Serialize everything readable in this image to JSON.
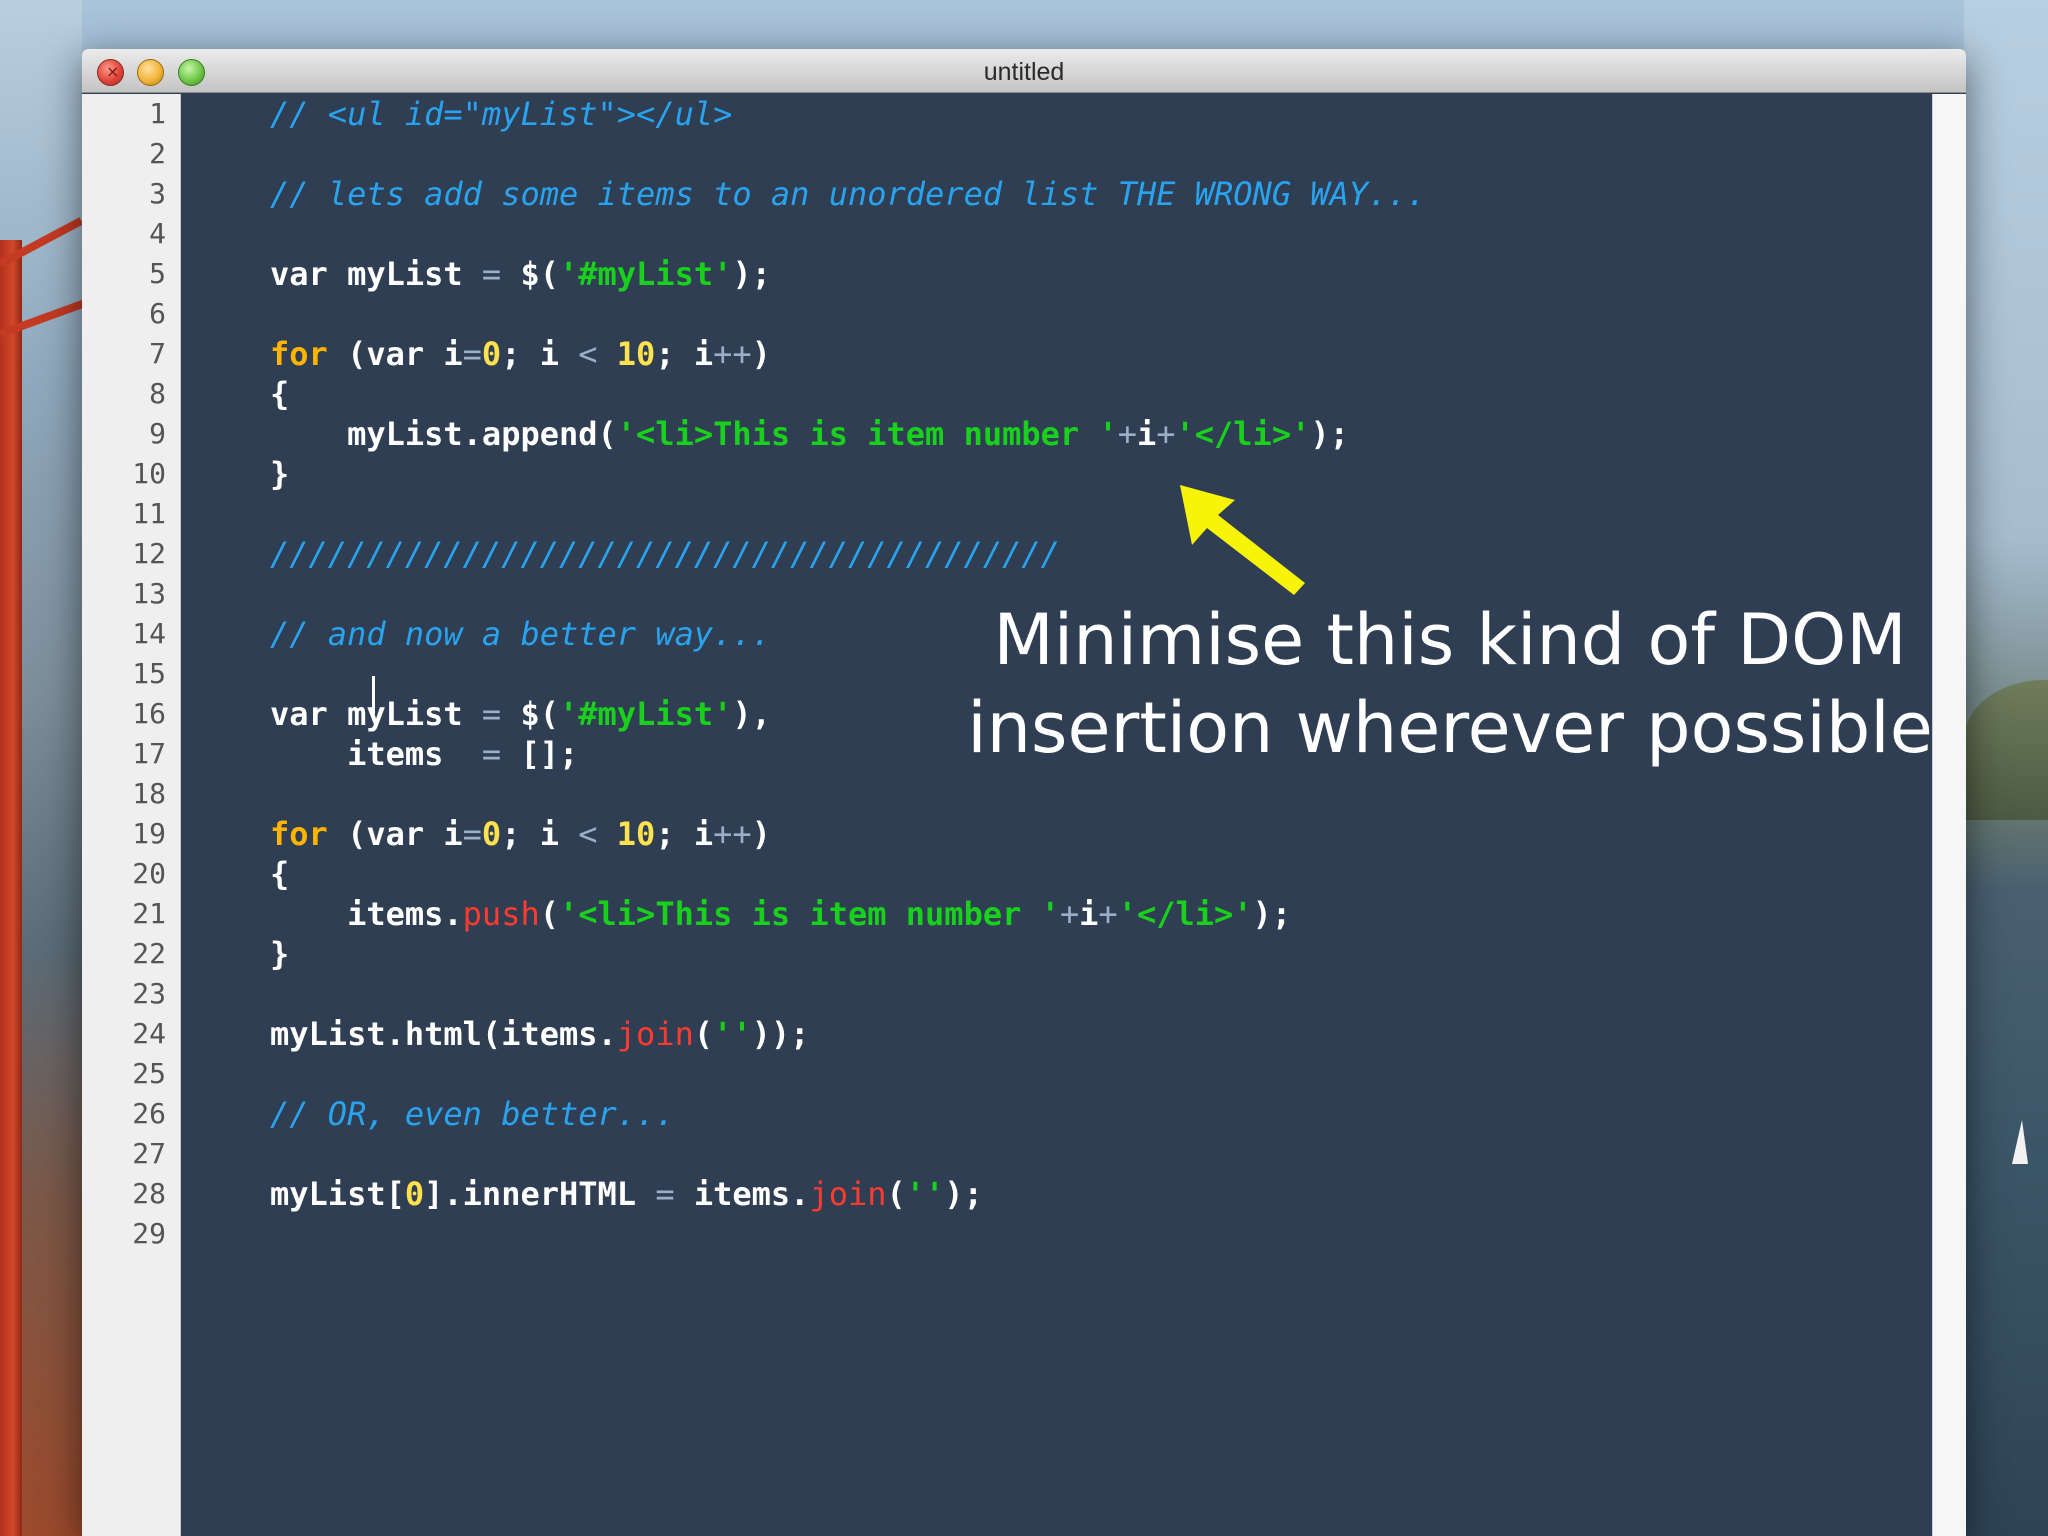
{
  "window": {
    "title": "untitled",
    "close_glyph": "×"
  },
  "icons": {
    "close": "close-icon",
    "minimize": "minimize-icon",
    "zoom": "zoom-icon",
    "annotation_arrow": "arrow-up-left-icon"
  },
  "colors": {
    "editor_background": "#2f3e52",
    "comment": "#2aa3ee",
    "keyword": "#ffb400",
    "string": "#19d11c",
    "number": "#ffe24d",
    "method": "#ff3b2f",
    "annotation_arrow": "#f7f40a"
  },
  "gutter": {
    "line_numbers": [
      "1",
      "2",
      "3",
      "4",
      "5",
      "6",
      "7",
      "8",
      "9",
      "10",
      "11",
      "12",
      "13",
      "14",
      "15",
      "16",
      "17",
      "18",
      "19",
      "20",
      "21",
      "22",
      "23",
      "24",
      "25",
      "26",
      "27",
      "28",
      "29"
    ]
  },
  "code": {
    "line_1": "// <ul id=\"myList\"></ul>",
    "line_3": "// lets add some items to an unordered list THE WRONG WAY...",
    "line_5": {
      "a": "var myList ",
      "op": "=",
      "b": " $(",
      "str": "'#myList'",
      "c": ");"
    },
    "line_7": {
      "kw": "for",
      "a": " (var i",
      "op1": "=",
      "num1": "0",
      "b": "; i ",
      "op2": "<",
      "c": " ",
      "num2": "10",
      "d": "; i",
      "op3": "++",
      "e": ")"
    },
    "line_8": "{",
    "line_9": {
      "a": "    myList.append(",
      "str1": "'<li>This is item number '",
      "op1": "+",
      "b": "i",
      "op2": "+",
      "str2": "'</li>'",
      "c": ");"
    },
    "line_10": "}",
    "line_12": "/////////////////////////////////////////",
    "line_14": "// and now a better way...",
    "line_16": {
      "a": "var myList ",
      "op": "=",
      "b": " $(",
      "str": "'#myList'",
      "c": "),"
    },
    "line_17": {
      "a": "    items  ",
      "op": "=",
      "b": " [];"
    },
    "line_19": {
      "kw": "for",
      "a": " (var i",
      "op1": "=",
      "num1": "0",
      "b": "; i ",
      "op2": "<",
      "c": " ",
      "num2": "10",
      "d": "; i",
      "op3": "++",
      "e": ")"
    },
    "line_20": "{",
    "line_21": {
      "a": "    items.",
      "fn": "push",
      "b": "(",
      "str1": "'<li>This is item number '",
      "op1": "+",
      "c": "i",
      "op2": "+",
      "str2": "'</li>'",
      "d": ");"
    },
    "line_22": "}",
    "line_24": {
      "a": "myList.html(items.",
      "fn": "join",
      "b": "(",
      "str": "''",
      "c": "));"
    },
    "line_26": "// OR, even better...",
    "line_28": {
      "a": "myList[",
      "num": "0",
      "b": "].innerHTML ",
      "op": "=",
      "c": " items.",
      "fn": "join",
      "d": "(",
      "str": "''",
      "e": ");"
    }
  },
  "annotation": {
    "line1": "Minimise this kind of DOM",
    "line2": "insertion wherever possible"
  }
}
